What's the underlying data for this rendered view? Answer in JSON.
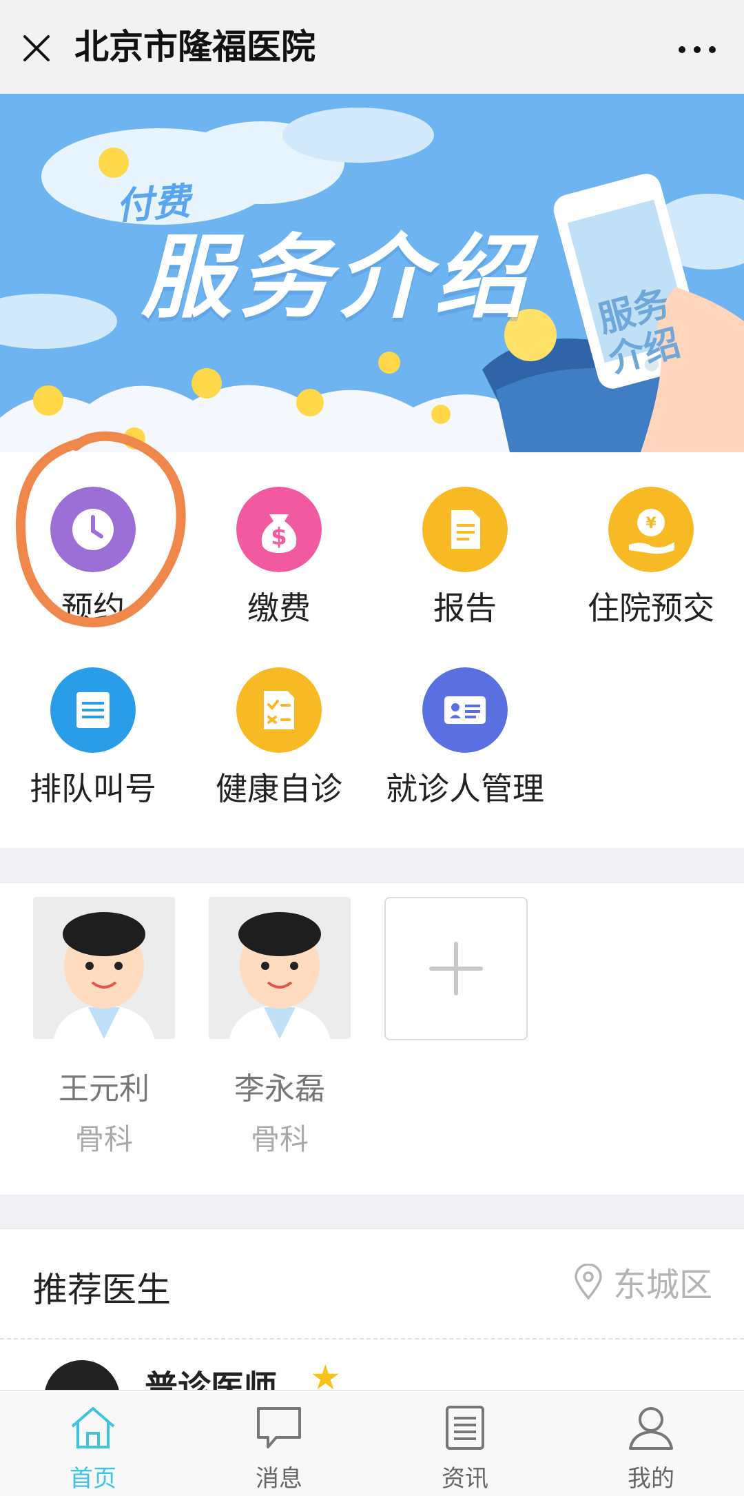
{
  "header": {
    "title": "北京市隆福医院"
  },
  "banner": {
    "small_text": "付费",
    "big_text": "服务介绍",
    "phone_text": "服务介绍"
  },
  "services": [
    {
      "label": "预约",
      "icon": "clock-icon",
      "color": "#9b6fd6"
    },
    {
      "label": "缴费",
      "icon": "money-bag-icon",
      "color": "#f25aa0"
    },
    {
      "label": "报告",
      "icon": "document-icon",
      "color": "#f7b924"
    },
    {
      "label": "住院预交",
      "icon": "yuan-hand-icon",
      "color": "#f7b924"
    },
    {
      "label": "排队叫号",
      "icon": "queue-list-icon",
      "color": "#2a9de8"
    },
    {
      "label": "健康自诊",
      "icon": "checklist-icon",
      "color": "#f7b924"
    },
    {
      "label": "就诊人管理",
      "icon": "id-card-icon",
      "color": "#5a6fe0"
    }
  ],
  "doctors": [
    {
      "name": "王元利",
      "dept": "骨科"
    },
    {
      "name": "李永磊",
      "dept": "骨科"
    }
  ],
  "recommend": {
    "title": "推荐医生",
    "location": "东城区",
    "first_item_name": "普诊医师"
  },
  "tabs": [
    {
      "label": "首页",
      "icon": "home-icon",
      "active": true
    },
    {
      "label": "消息",
      "icon": "chat-bubble-icon",
      "active": false
    },
    {
      "label": "资讯",
      "icon": "news-icon",
      "active": false
    },
    {
      "label": "我的",
      "icon": "user-icon",
      "active": false
    }
  ],
  "colors": {
    "accent": "#3ec3e0",
    "annotation_circle": "#f0874a",
    "banner_sky": "#6db4f0"
  }
}
